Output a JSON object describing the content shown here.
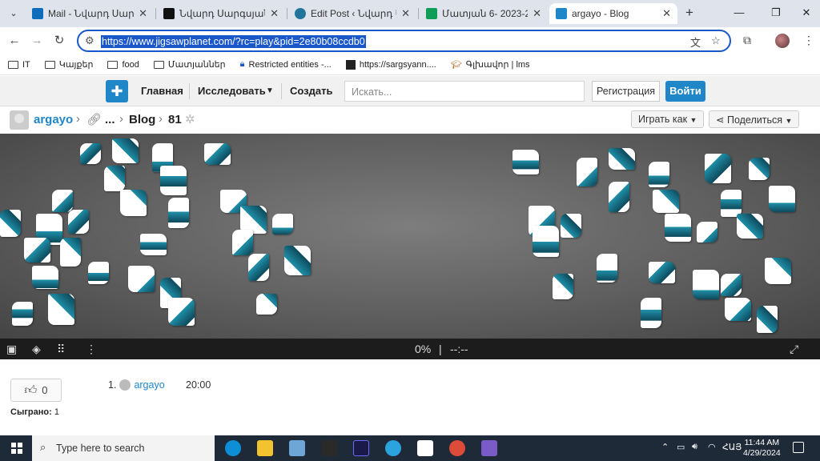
{
  "browser": {
    "tabs": [
      {
        "title": "Mail - Նվարդ Սարգսյա",
        "icon": "outlook-icon",
        "color": "#0f6cbd",
        "active": false
      },
      {
        "title": "Նվարդ Սարգսյան — «",
        "icon": "site-icon",
        "color": "#111111",
        "active": false
      },
      {
        "title": "Edit Post ‹ Նվարդ Սար",
        "icon": "wordpress-icon",
        "color": "#21759b",
        "active": false
      },
      {
        "title": "Մատյան 6- 2023-2024",
        "icon": "sheets-icon",
        "color": "#0f9d58",
        "active": false
      },
      {
        "title": "argayo - Blog",
        "icon": "jigsaw-icon",
        "color": "#1f86c8",
        "active": true
      }
    ],
    "url": "https://www.jigsawplanet.com/?rc=play&pid=2e80b08ccdb0",
    "bookmarks": [
      {
        "label": "IT",
        "icon": "folder-icon"
      },
      {
        "label": "Կայքեր",
        "icon": "folder-icon"
      },
      {
        "label": "food",
        "icon": "folder-icon"
      },
      {
        "label": "Մատյաններ",
        "icon": "folder-icon"
      },
      {
        "label": "Restricted entities -...",
        "icon": "lock-icon"
      },
      {
        "label": "https://sargsyann....",
        "icon": "site-icon"
      },
      {
        "label": "Գլխավոր | lms",
        "icon": "lms-icon"
      }
    ]
  },
  "site": {
    "nav": {
      "home": "Главная",
      "explore": "Исследовать",
      "create": "Создать"
    },
    "search_placeholder": "Искать...",
    "register": "Регистрация",
    "login": "Войти"
  },
  "breadcrumb": {
    "user": "argayo",
    "ellipsis": "...",
    "folder": "Blog",
    "pieces": "81"
  },
  "actions": {
    "play_as": "Играть как",
    "share": "Поделиться"
  },
  "board": {
    "progress": "0%",
    "divider": "|",
    "timer": "--:--",
    "piece_color": "#1f8fa8"
  },
  "stats": {
    "likes": "0",
    "played_label": "Сыграно:",
    "played_count": "1",
    "leaderboard": [
      {
        "rank": "1.",
        "user": "argayo",
        "time": "20:00"
      }
    ]
  },
  "taskbar": {
    "search_placeholder": "Type here to search",
    "lang": "ՀԱՅ",
    "time": "11:44 AM",
    "date": "4/29/2024",
    "notifications": "1"
  }
}
